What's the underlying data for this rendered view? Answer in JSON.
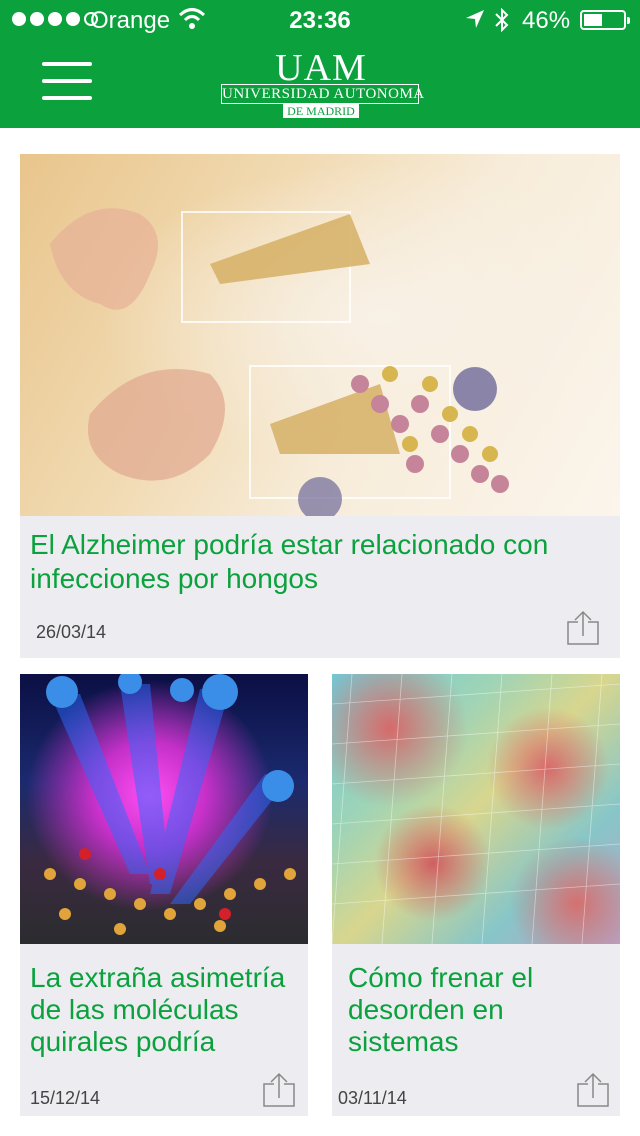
{
  "status_bar": {
    "carrier": "Orange",
    "time": "23:36",
    "battery_percent": "46%",
    "signal_bars_filled": 4,
    "signal_bars_total": 5
  },
  "header": {
    "logo_mark": "UAM",
    "logo_line1": "UNIVERSIDAD AUTONOMA",
    "logo_line2": "DE MADRID",
    "background_color": "#0ba23e"
  },
  "articles": [
    {
      "title": "El Alzheimer podría estar relacionado con infecciones por hongos",
      "date": "26/03/14"
    },
    {
      "title": "La extraña asimetría de las moléculas quirales podría estar…",
      "date": "15/12/14"
    },
    {
      "title": "Cómo frenar el desorden en sistemas bidimensionales na…",
      "date": "03/11/14"
    }
  ],
  "colors": {
    "accent": "#0ba23e",
    "card_background": "#ededf1",
    "title_text": "#0ba23e"
  },
  "icons": {
    "menu": "hamburger-icon",
    "share": "share-icon",
    "wifi": "wifi-icon",
    "location": "location-arrow-icon",
    "bluetooth": "bluetooth-icon",
    "battery": "battery-icon"
  }
}
